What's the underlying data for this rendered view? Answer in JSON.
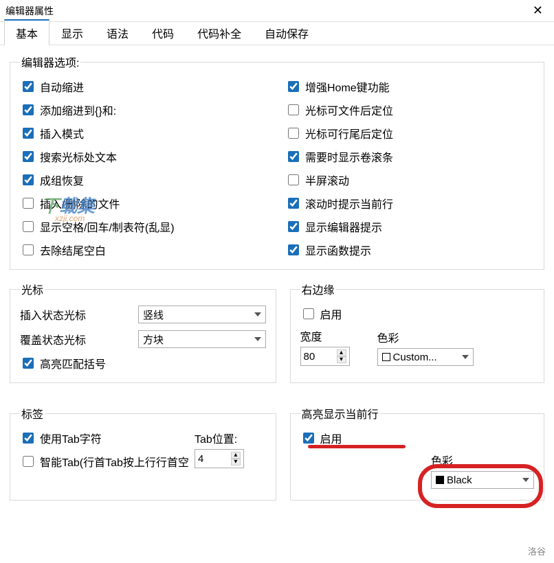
{
  "window": {
    "title": "编辑器属性"
  },
  "tabs": [
    "基本",
    "显示",
    "语法",
    "代码",
    "代码补全",
    "自动保存"
  ],
  "active_tab": 0,
  "editor_options": {
    "legend": "编辑器选项:",
    "left": [
      {
        "label": "自动缩进",
        "checked": true
      },
      {
        "label": "添加缩进到{}和:",
        "checked": true
      },
      {
        "label": "插入模式",
        "checked": true
      },
      {
        "label": "搜索光标处文本",
        "checked": true
      },
      {
        "label": "成组恢复",
        "checked": true
      },
      {
        "label": "插入/删除的文件",
        "checked": false
      },
      {
        "label": "显示空格/回车/制表符(乱显)",
        "checked": false
      },
      {
        "label": "去除结尾空白",
        "checked": false
      }
    ],
    "right": [
      {
        "label": "增强Home键功能",
        "checked": true
      },
      {
        "label": "光标可文件后定位",
        "checked": false
      },
      {
        "label": "光标可行尾后定位",
        "checked": false
      },
      {
        "label": "需要时显示卷滚条",
        "checked": true
      },
      {
        "label": "半屏滚动",
        "checked": false
      },
      {
        "label": "滚动时提示当前行",
        "checked": true
      },
      {
        "label": "显示编辑器提示",
        "checked": true
      },
      {
        "label": "显示函数提示",
        "checked": true
      }
    ]
  },
  "cursor": {
    "legend": "光标",
    "insert_label": "插入状态光标",
    "insert_value": "竖线",
    "overwrite_label": "覆盖状态光标",
    "overwrite_value": "方块",
    "bracket_label": "高亮匹配括号",
    "bracket_checked": true
  },
  "right_edge": {
    "legend": "右边缘",
    "enable_label": "启用",
    "enable_checked": false,
    "width_label": "宽度",
    "width_value": "80",
    "color_label": "色彩",
    "color_value": "Custom...",
    "color_swatch": "#ffffff"
  },
  "tab_section": {
    "legend": "标签",
    "use_tab_label": "使用Tab字符",
    "use_tab_checked": true,
    "smart_tab_label": "智能Tab(行首Tab按上行行首空",
    "smart_tab_checked": false,
    "pos_label": "Tab位置:",
    "pos_value": "4"
  },
  "highlight": {
    "legend": "高亮显示当前行",
    "enable_label": "启用",
    "enable_checked": true,
    "color_label": "色彩",
    "color_value": "Black",
    "color_swatch": "#000000"
  },
  "watermark": {
    "zh1": "下",
    "zh2": "载集",
    "en": "xzji.com"
  },
  "watermark2": "洛谷"
}
